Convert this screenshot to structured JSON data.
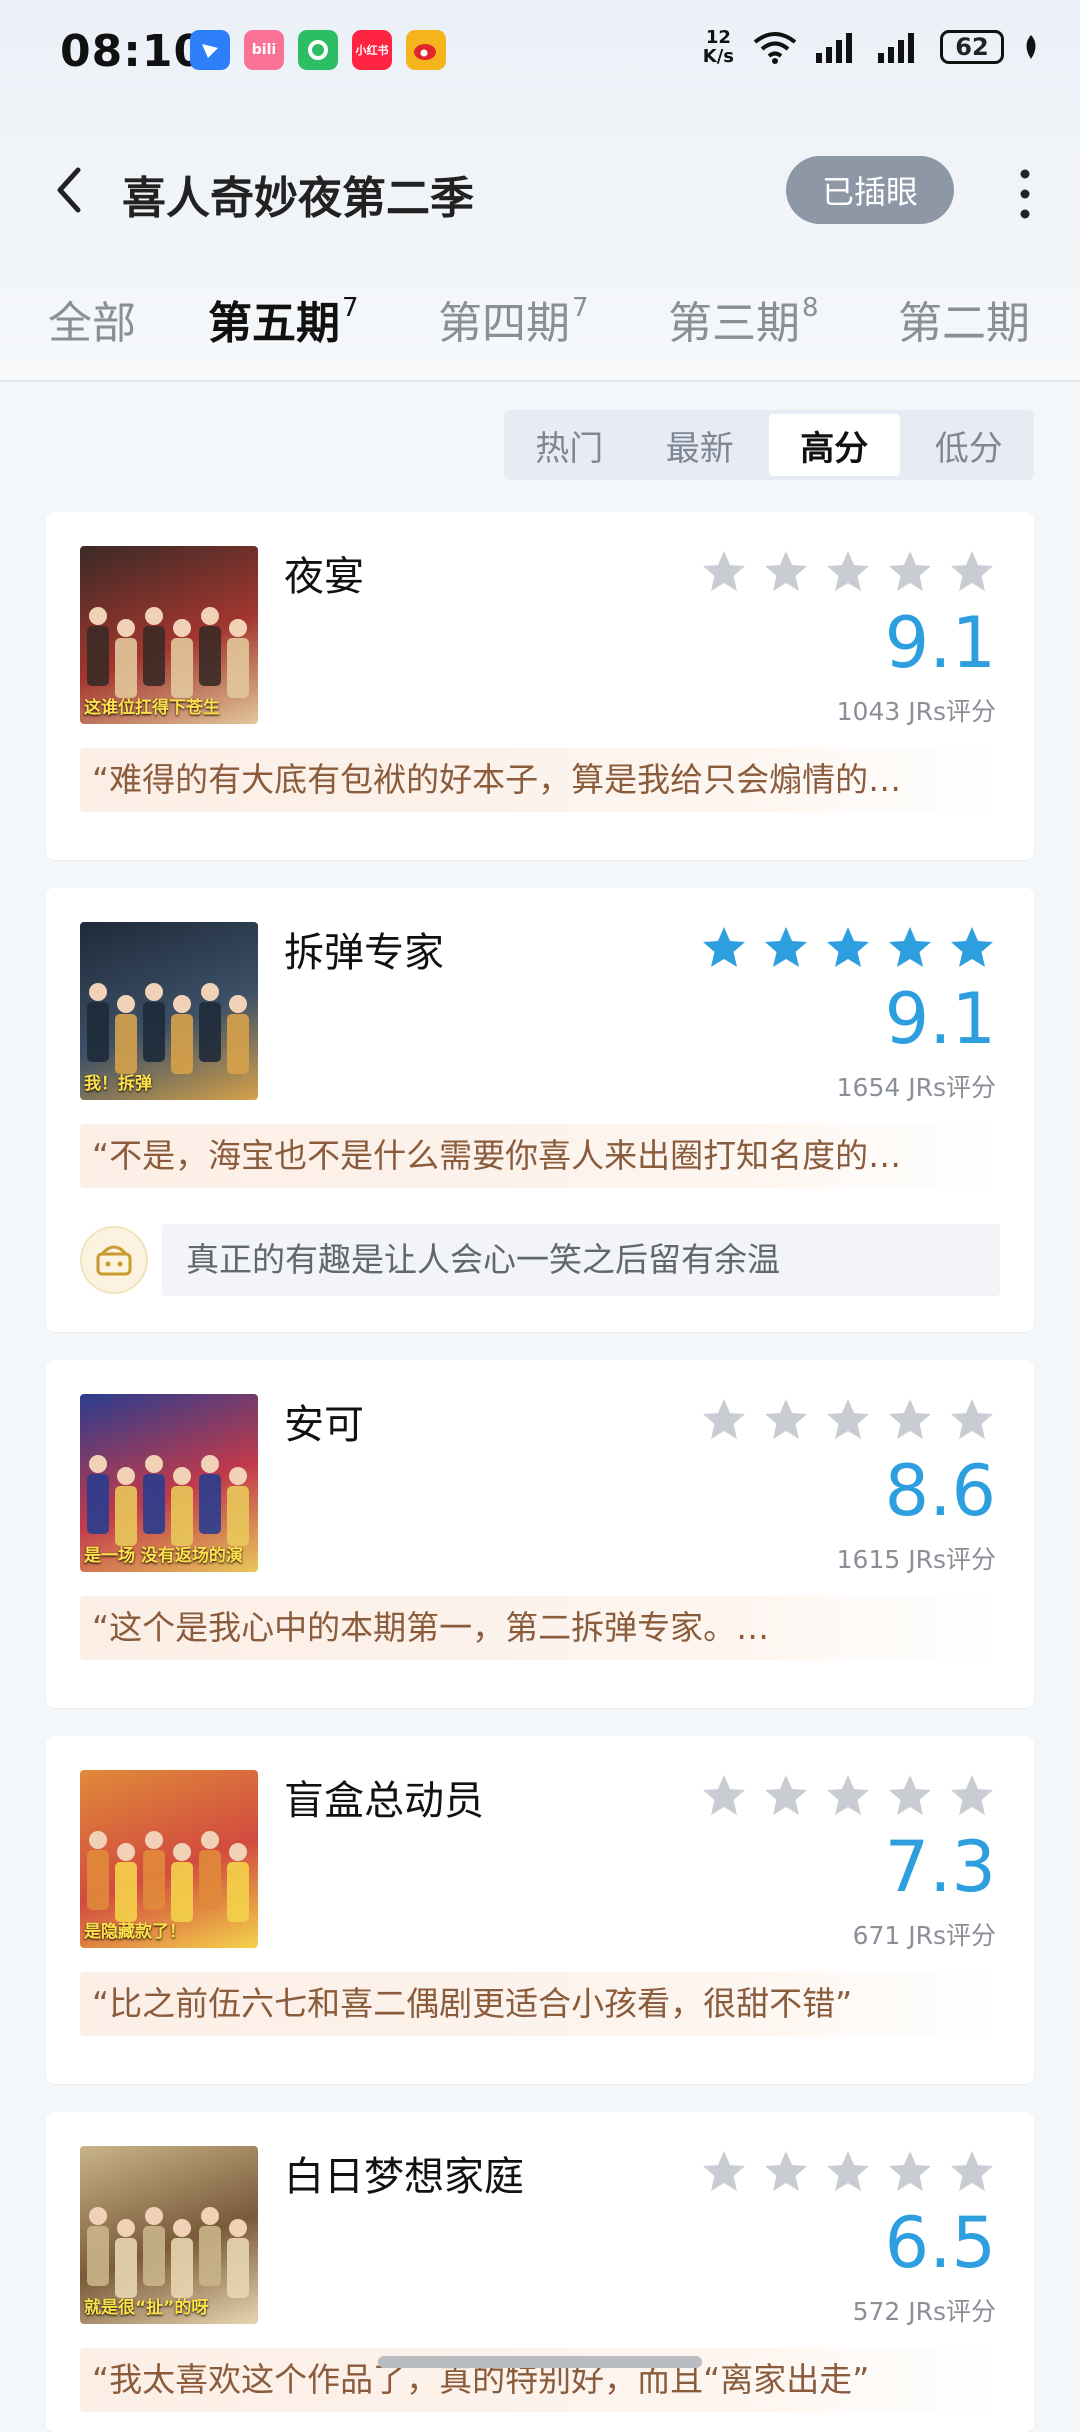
{
  "status_bar": {
    "time": "08:10",
    "net_speed_value": "12",
    "net_speed_unit": "K/s",
    "battery": "62",
    "apps": [
      {
        "name": "feishu-icon",
        "label": "",
        "color": "#2d7ff9"
      },
      {
        "name": "bilibili-icon",
        "label": "bili",
        "color": "#fb7299"
      },
      {
        "name": "green-app-icon",
        "label": "",
        "color": "#2dbd65"
      },
      {
        "name": "xiaohongshu-icon",
        "label": "小红书",
        "color": "#ff2442"
      },
      {
        "name": "weibo-icon",
        "label": "",
        "color": "#f5b41b"
      }
    ]
  },
  "header": {
    "title": "喜人奇妙夜第二季",
    "tag_button": "已插眼"
  },
  "tabs": [
    {
      "label": "全部",
      "badge": "",
      "active": false
    },
    {
      "label": "第五期",
      "badge": "7",
      "active": true
    },
    {
      "label": "第四期",
      "badge": "7",
      "active": false
    },
    {
      "label": "第三期",
      "badge": "8",
      "active": false
    },
    {
      "label": "第二期",
      "badge": "",
      "active": false
    }
  ],
  "sort": {
    "options": [
      "热门",
      "最新",
      "高分",
      "低分"
    ],
    "active": "高分"
  },
  "items": [
    {
      "title": "夜宴",
      "stars_filled": 0,
      "score": "9.1",
      "ratings": "1043 JRs评分",
      "quote": "“难得的有大底有包袱的好本子，算是我给只会煽情的…",
      "thumb_caption": "这谁位扛得下苍生",
      "thumb_colors": [
        "#3b2a26",
        "#a3362f",
        "#e2c79a"
      ]
    },
    {
      "title": "拆弹专家",
      "stars_filled": 5,
      "score": "9.1",
      "ratings": "1654 JRs评分",
      "quote": "“不是，海宝也不是什么需要你喜人来出圈打知名度的…",
      "sub_comment": "真正的有趣是让人会心一笑之后留有余温",
      "thumb_caption": "我！拆弹",
      "thumb_colors": [
        "#1e2a3a",
        "#3d5066",
        "#d6a24a"
      ]
    },
    {
      "title": "安可",
      "stars_filled": 0,
      "score": "8.6",
      "ratings": "1615 JRs评分",
      "quote": "“这个是我心中的本期第一，第二拆弹专家。…",
      "thumb_caption": "是一场 没有返场的演",
      "thumb_colors": [
        "#2a3d8f",
        "#c23a4a",
        "#e8c85a"
      ]
    },
    {
      "title": "盲盒总动员",
      "stars_filled": 0,
      "score": "7.3",
      "ratings": "671 JRs评分",
      "quote": "“比之前伍六七和喜二偶剧更适合小孩看，很甜不错”",
      "thumb_caption": "是隐藏款了！",
      "thumb_colors": [
        "#e08a3a",
        "#d24b3f",
        "#f4d24a"
      ]
    },
    {
      "title": "白日梦想家庭",
      "stars_filled": 0,
      "score": "6.5",
      "ratings": "572 JRs评分",
      "quote": "“我太喜欢这个作品了，真的特别好，而且“离家出走”",
      "thumb_caption": "就是很“扯”的呀",
      "thumb_colors": [
        "#c9b48a",
        "#7a5a3a",
        "#e8d6b0"
      ]
    }
  ],
  "colors": {
    "score_blue": "#2e9fde",
    "star_filled": "#2e9fde",
    "star_empty": "#c9ccd3",
    "quote_text": "#8a5c3c"
  }
}
